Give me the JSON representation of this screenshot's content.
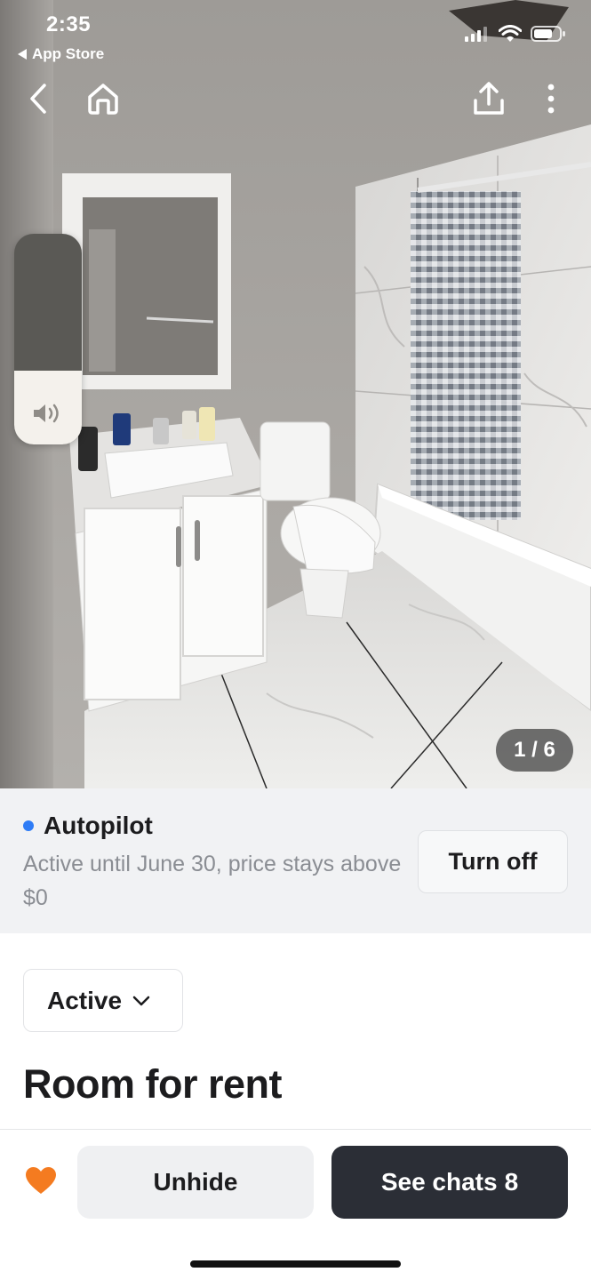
{
  "status_bar": {
    "time": "2:35",
    "back_app": "App Store"
  },
  "nav": {
    "back_icon": "chevron-left-icon",
    "home_icon": "home-icon",
    "share_icon": "share-icon",
    "more_icon": "more-vertical-icon"
  },
  "volume": {
    "level": 0.35,
    "icon": "speaker-icon"
  },
  "photo": {
    "current": "1",
    "total": "6",
    "counter": "1 / 6"
  },
  "autopilot": {
    "title": "Autopilot",
    "description": "Active until June 30, price stays above $0",
    "turn_off_label": "Turn off",
    "dot_color": "#2e7cf6"
  },
  "listing": {
    "status": "Active",
    "title": "Room for rent"
  },
  "bottom_bar": {
    "heart_color": "#f47b20",
    "unhide_label": "Unhide",
    "chats_label": "See chats",
    "chats_count": "8"
  }
}
